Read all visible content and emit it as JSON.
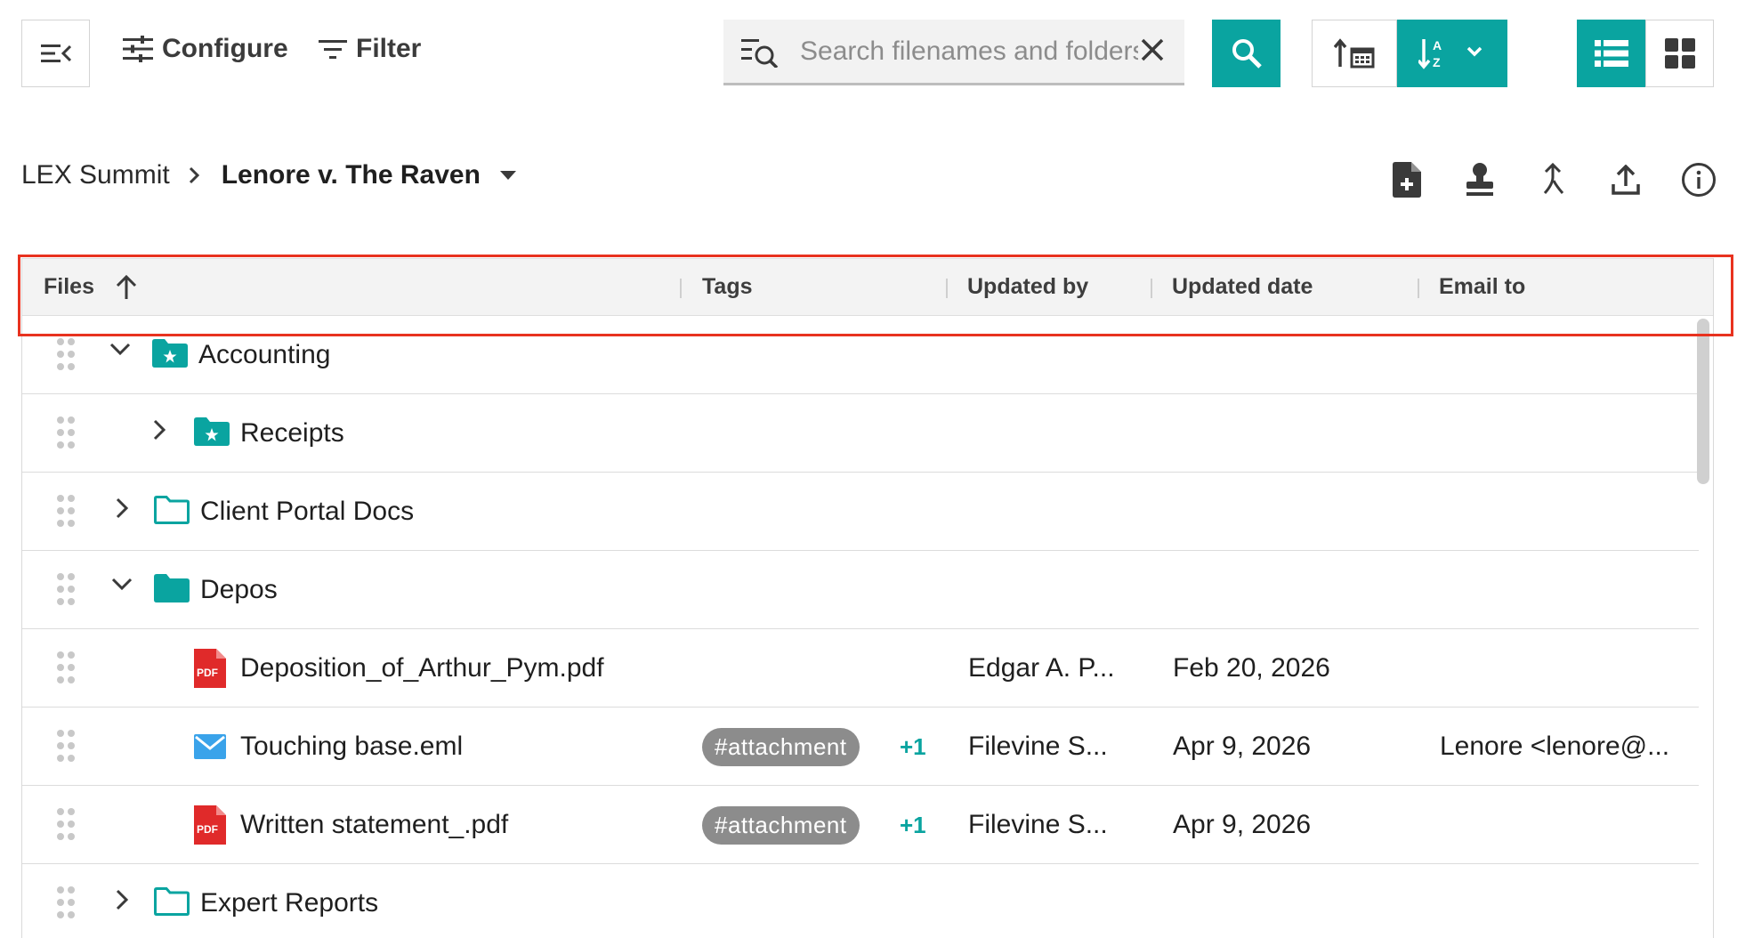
{
  "toolbar": {
    "configure_label": "Configure",
    "filter_label": "Filter",
    "search_placeholder": "Search filenames and folders",
    "search_value": "",
    "accent_color": "#0aa4a0"
  },
  "breadcrumb": {
    "root": "LEX Summit",
    "current": "Lenore v. The Raven"
  },
  "table": {
    "columns": {
      "files": "Files",
      "tags": "Tags",
      "updated_by": "Updated by",
      "updated_date": "Updated date",
      "email_to": "Email to"
    },
    "rows": [
      {
        "name": "Accounting",
        "updated_by": "",
        "updated_date": "",
        "email_to": "",
        "tag": "",
        "tag_more": ""
      },
      {
        "name": "Receipts",
        "updated_by": "",
        "updated_date": "",
        "email_to": "",
        "tag": "",
        "tag_more": ""
      },
      {
        "name": "Client Portal Docs",
        "updated_by": "",
        "updated_date": "",
        "email_to": "",
        "tag": "",
        "tag_more": ""
      },
      {
        "name": "Depos",
        "updated_by": "",
        "updated_date": "",
        "email_to": "",
        "tag": "",
        "tag_more": ""
      },
      {
        "name": "Deposition_of_Arthur_Pym.pdf",
        "updated_by": "Edgar A. P...",
        "updated_date": "Feb 20, 2026",
        "email_to": "",
        "tag": "",
        "tag_more": ""
      },
      {
        "name": "Touching base.eml",
        "updated_by": "Filevine S...",
        "updated_date": "Apr 9, 2026",
        "email_to": "Lenore <lenore@...",
        "tag": "#attachment",
        "tag_more": "+1"
      },
      {
        "name": "Written statement_.pdf",
        "updated_by": "Filevine S...",
        "updated_date": "Apr 9, 2026",
        "email_to": "",
        "tag": "#attachment",
        "tag_more": "+1"
      },
      {
        "name": "Expert Reports",
        "updated_by": "",
        "updated_date": "",
        "email_to": "",
        "tag": "",
        "tag_more": ""
      }
    ]
  },
  "icons": {
    "menu": "collapse-menu-icon",
    "configure": "sliders-icon",
    "filter": "filter-icon",
    "search": "search-icon",
    "clear": "close-icon",
    "sort_date": "sort-date-icon",
    "sort_az": "sort-alpha-icon",
    "view_list": "list-view-icon",
    "view_grid": "grid-view-icon",
    "new_doc": "new-document-icon",
    "stamp": "stamp-icon",
    "merge": "merge-icon",
    "upload": "upload-icon",
    "info": "info-icon"
  }
}
